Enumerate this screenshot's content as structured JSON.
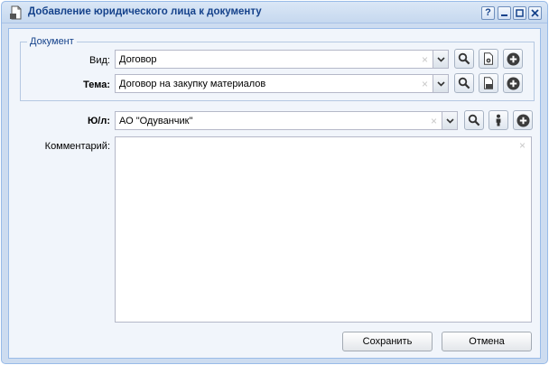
{
  "window": {
    "title": "Добавление юридического лица к документу",
    "help_glyph": "?",
    "icon": "document-add-icon"
  },
  "document_group": {
    "legend": "Документ",
    "type": {
      "label": "Вид:",
      "value": "Договор"
    },
    "subject": {
      "label": "Тема:",
      "value": "Договор на закупку материалов"
    }
  },
  "legal_entity": {
    "label": "Ю/л:",
    "value": "АО \"Одуванчик\""
  },
  "comment": {
    "label": "Комментарий:",
    "value": ""
  },
  "clear_glyph": "×",
  "buttons": {
    "save": "Сохранить",
    "cancel": "Отмена"
  },
  "colors": {
    "title_text": "#15428b",
    "window_border": "#99bbe8",
    "panel_bg": "#f1f5fb",
    "add_icon": "#3c3c3c"
  }
}
